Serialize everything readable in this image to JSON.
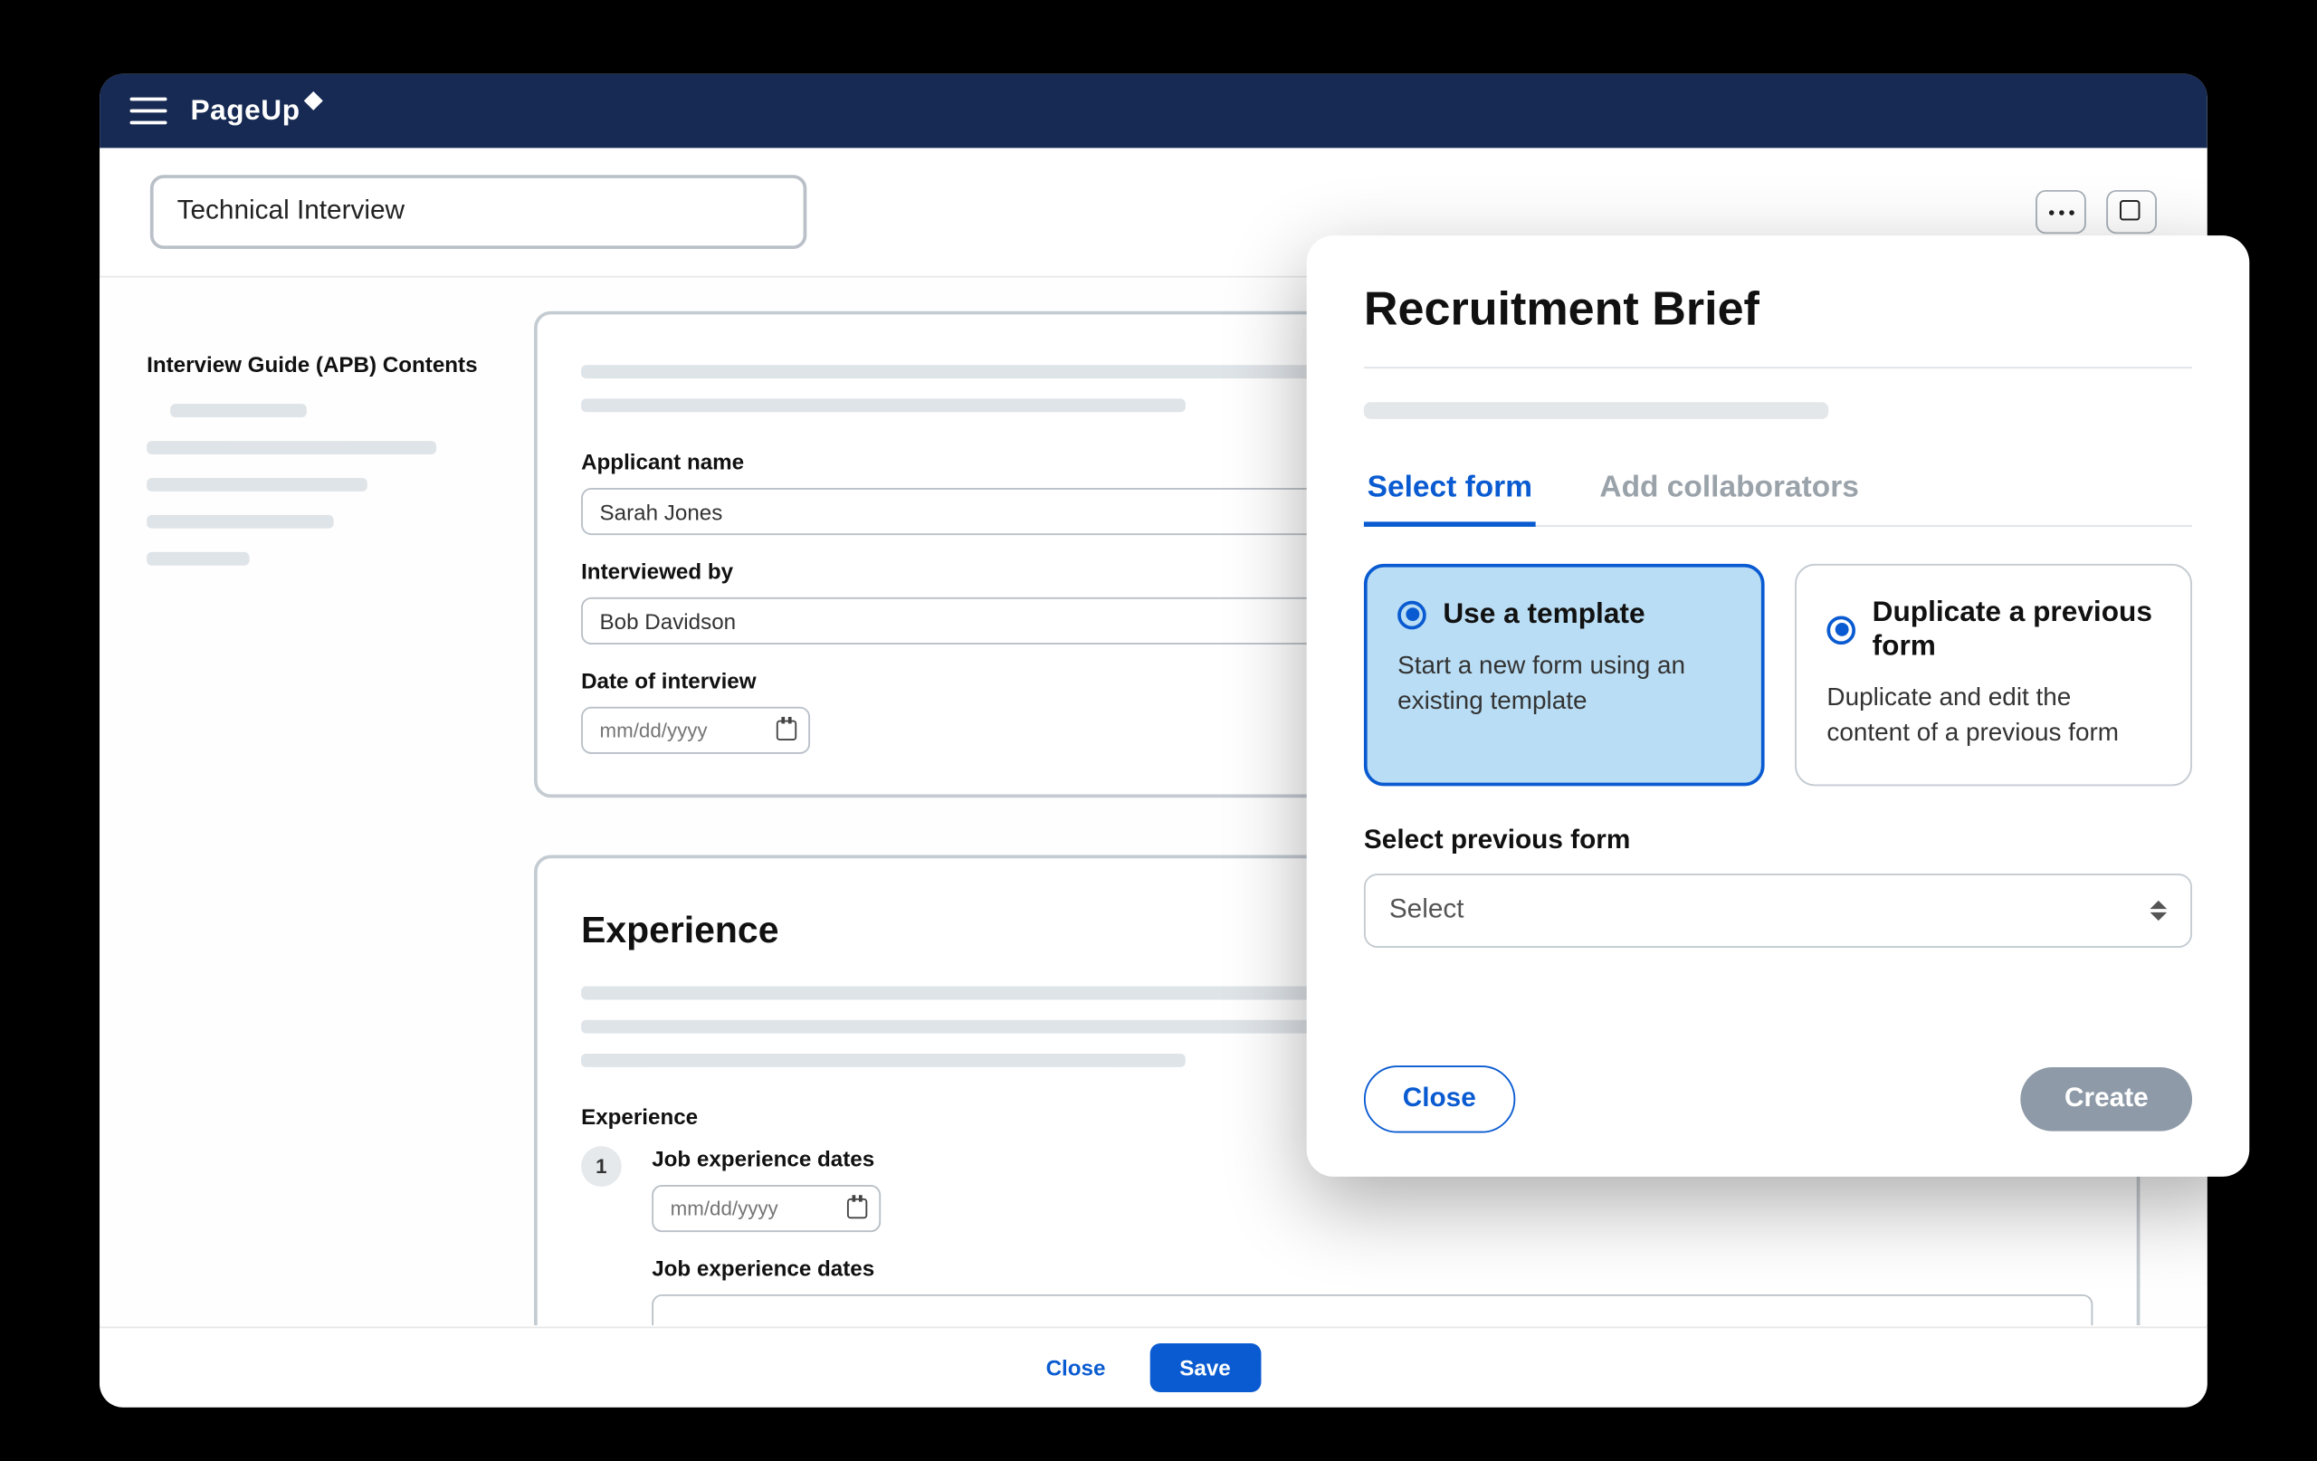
{
  "brand": "PageUp",
  "titleInput": "Technical Interview",
  "sidebar": {
    "heading": "Interview Guide (APB) Contents"
  },
  "form1": {
    "fields": {
      "applicantName": {
        "label": "Applicant name",
        "value": "Sarah Jones"
      },
      "interviewedBy": {
        "label": "Interviewed by",
        "value": "Bob Davidson"
      },
      "dateOfInterview": {
        "label": "Date of interview",
        "placeholder": "mm/dd/yyyy"
      }
    }
  },
  "form2": {
    "sectionTitle": "Experience",
    "groupLabel": "Experience",
    "rowNumber": "1",
    "jobDates1": {
      "label": "Job experience dates",
      "placeholder": "mm/dd/yyyy"
    },
    "jobDates2": {
      "label": "Job experience dates"
    }
  },
  "footer": {
    "close": "Close",
    "save": "Save"
  },
  "modal": {
    "title": "Recruitment Brief",
    "tabs": {
      "selectForm": "Select form",
      "addCollaborators": "Add collaborators"
    },
    "options": {
      "template": {
        "title": "Use a template",
        "desc": "Start a new form using an existing template"
      },
      "duplicate": {
        "title": "Duplicate a previous form",
        "desc": "Duplicate and edit the content of a previous form"
      }
    },
    "selectPrevLabel": "Select previous form",
    "selectPlaceholder": "Select",
    "buttons": {
      "close": "Close",
      "create": "Create"
    }
  }
}
